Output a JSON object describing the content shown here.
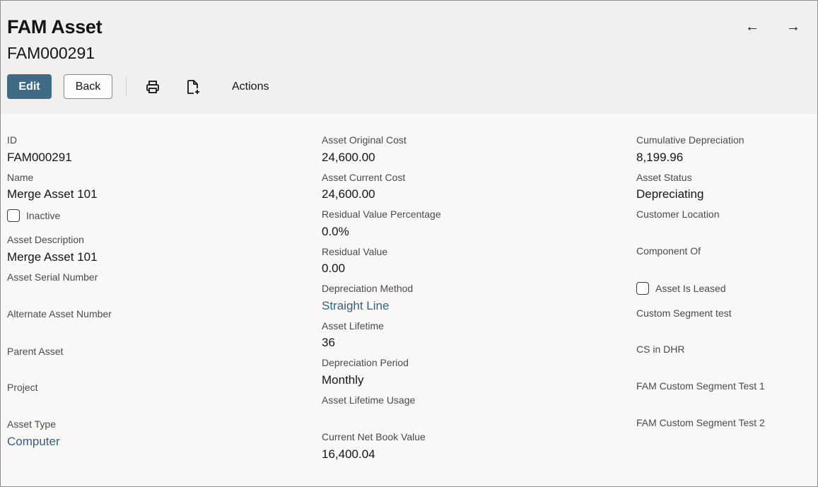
{
  "header": {
    "title": "FAM Asset",
    "record_id": "FAM000291",
    "prev_arrow": "←",
    "next_arrow": "→",
    "edit_label": "Edit",
    "back_label": "Back",
    "actions_label": "Actions"
  },
  "col1": {
    "id_label": "ID",
    "id_value": "FAM000291",
    "name_label": "Name",
    "name_value": "Merge Asset 101",
    "inactive_label": "Inactive",
    "description_label": "Asset Description",
    "description_value": "Merge Asset 101",
    "serial_label": "Asset Serial Number",
    "alternate_label": "Alternate Asset Number",
    "parent_label": "Parent Asset",
    "project_label": "Project",
    "type_label": "Asset Type",
    "type_value": "Computer"
  },
  "col2": {
    "orig_cost_label": "Asset Original Cost",
    "orig_cost_value": "24,600.00",
    "curr_cost_label": "Asset Current Cost",
    "curr_cost_value": "24,600.00",
    "resid_pct_label": "Residual Value Percentage",
    "resid_pct_value": "0.0%",
    "resid_label": "Residual Value",
    "resid_value": "0.00",
    "dep_method_label": "Depreciation Method",
    "dep_method_value": "Straight Line",
    "lifetime_label": "Asset Lifetime",
    "lifetime_value": "36",
    "dep_period_label": "Depreciation Period",
    "dep_period_value": "Monthly",
    "lifetime_usage_label": "Asset Lifetime Usage",
    "nbv_label": "Current Net Book Value",
    "nbv_value": "16,400.04"
  },
  "col3": {
    "cum_dep_label": "Cumulative Depreciation",
    "cum_dep_value": "8,199.96",
    "status_label": "Asset Status",
    "status_value": "Depreciating",
    "cust_loc_label": "Customer Location",
    "component_label": "Component Of",
    "leased_label": "Asset Is Leased",
    "cs_test_label": "Custom Segment test",
    "cs_dhr_label": "CS in DHR",
    "fam_cs1_label": "FAM Custom Segment Test 1",
    "fam_cs2_label": "FAM Custom Segment Test 2"
  },
  "icons": [
    "print-icon",
    "new-document-icon",
    "arrow-left-icon",
    "arrow-right-icon"
  ],
  "colors": {
    "primary": "#3f6b85",
    "link": "#326283",
    "header_bg": "#f1f0ef",
    "body_bg": "#f9f8f6"
  }
}
